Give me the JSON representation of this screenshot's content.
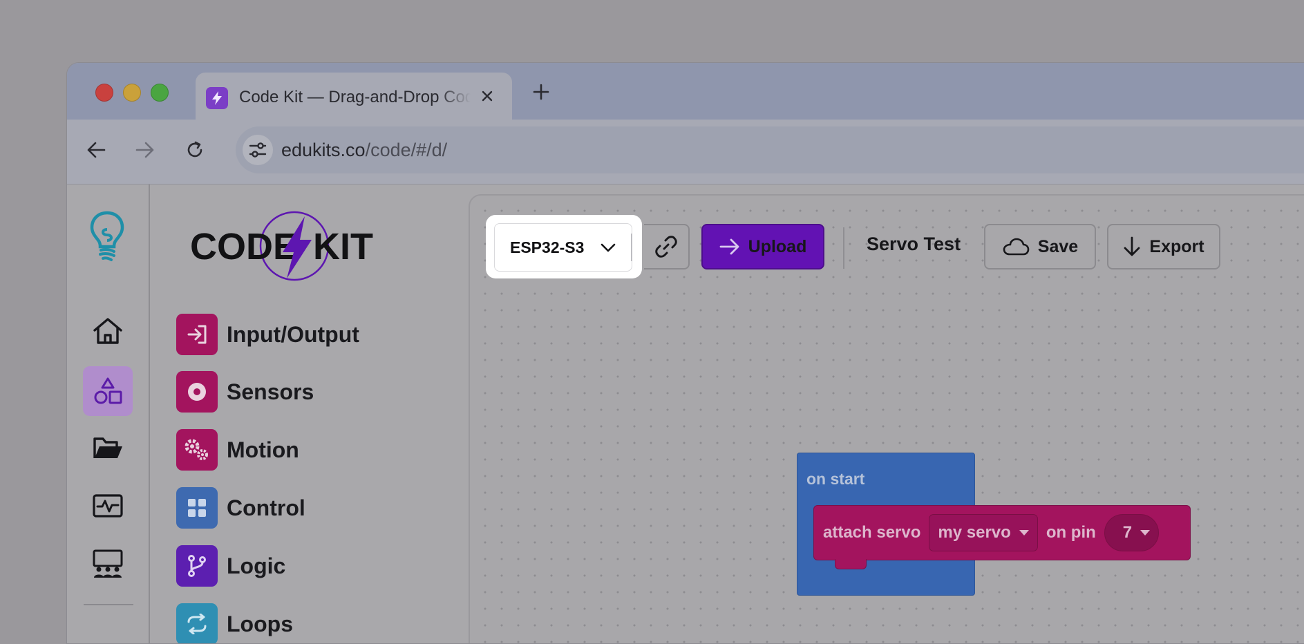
{
  "browser": {
    "tab_title": "Code Kit — Drag-and-Drop Code Editor",
    "url_host": "edukits.co",
    "url_path": "/code/#/d/"
  },
  "rail": {
    "items": [
      {
        "name": "home",
        "icon": "home-icon"
      },
      {
        "name": "blocks",
        "icon": "shapes-icon",
        "active": true
      },
      {
        "name": "projects",
        "icon": "folder-open-icon"
      },
      {
        "name": "monitor",
        "icon": "activity-monitor-icon"
      },
      {
        "name": "classroom",
        "icon": "classroom-icon"
      }
    ]
  },
  "logo": {
    "text_left": "CODE",
    "text_right": "KIT"
  },
  "categories": [
    {
      "label": "Input/Output",
      "color": "#a3145e",
      "icon": "sign-in-icon"
    },
    {
      "label": "Sensors",
      "color": "#a3145e",
      "icon": "target-icon"
    },
    {
      "label": "Motion",
      "color": "#a3145e",
      "icon": "gears-icon"
    },
    {
      "label": "Control",
      "color": "#3e6ab0",
      "icon": "grid-icon"
    },
    {
      "label": "Logic",
      "color": "#5c1fb0",
      "icon": "branch-icon"
    },
    {
      "label": "Loops",
      "color": "#2f8fb3",
      "icon": "loop-icon"
    }
  ],
  "toolbar": {
    "board": "ESP32-S3",
    "upload_label": "Upload",
    "project_name": "Servo Test",
    "save_label": "Save",
    "export_label": "Export"
  },
  "blocks": {
    "hat_label": "on start",
    "statement": {
      "prefix": "attach servo",
      "servo_var": "my servo",
      "middle": "on pin",
      "pin": "7"
    }
  },
  "colors": {
    "accent": "#6212b3",
    "hat_block": "#3866b1",
    "motion_block": "#a3145e"
  }
}
